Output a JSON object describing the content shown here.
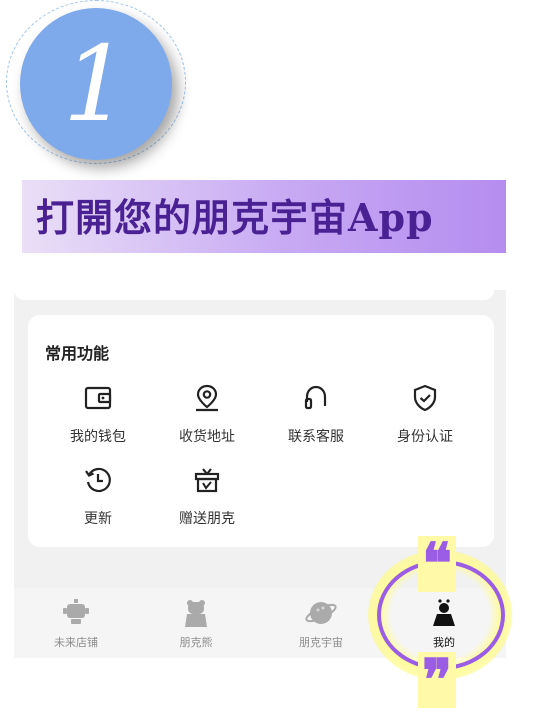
{
  "step": {
    "number": "1"
  },
  "banner": {
    "title": "打開您的朋克宇宙App"
  },
  "common_functions": {
    "title": "常用功能",
    "items": [
      {
        "label": "我的钱包",
        "icon": "wallet-icon"
      },
      {
        "label": "收货地址",
        "icon": "location-pin-icon"
      },
      {
        "label": "联系客服",
        "icon": "headset-icon"
      },
      {
        "label": "身份认证",
        "icon": "shield-check-icon"
      },
      {
        "label": "更新",
        "icon": "history-icon"
      },
      {
        "label": "赠送朋克",
        "icon": "gift-box-icon"
      }
    ]
  },
  "bottom_nav": {
    "items": [
      {
        "label": "未来店铺",
        "icon": "robot-icon",
        "active": false
      },
      {
        "label": "朋克熊",
        "icon": "bear-icon",
        "active": false
      },
      {
        "label": "朋克宇宙",
        "icon": "planet-icon",
        "active": false
      },
      {
        "label": "我的",
        "icon": "profile-icon",
        "active": true
      }
    ]
  },
  "highlight": {
    "open_quote": "❝",
    "close_quote": "❞"
  },
  "colors": {
    "accent": "#9b5de5",
    "title_text": "#4a2193",
    "badge": "#7ea9ea",
    "glow": "#fff9a8"
  }
}
